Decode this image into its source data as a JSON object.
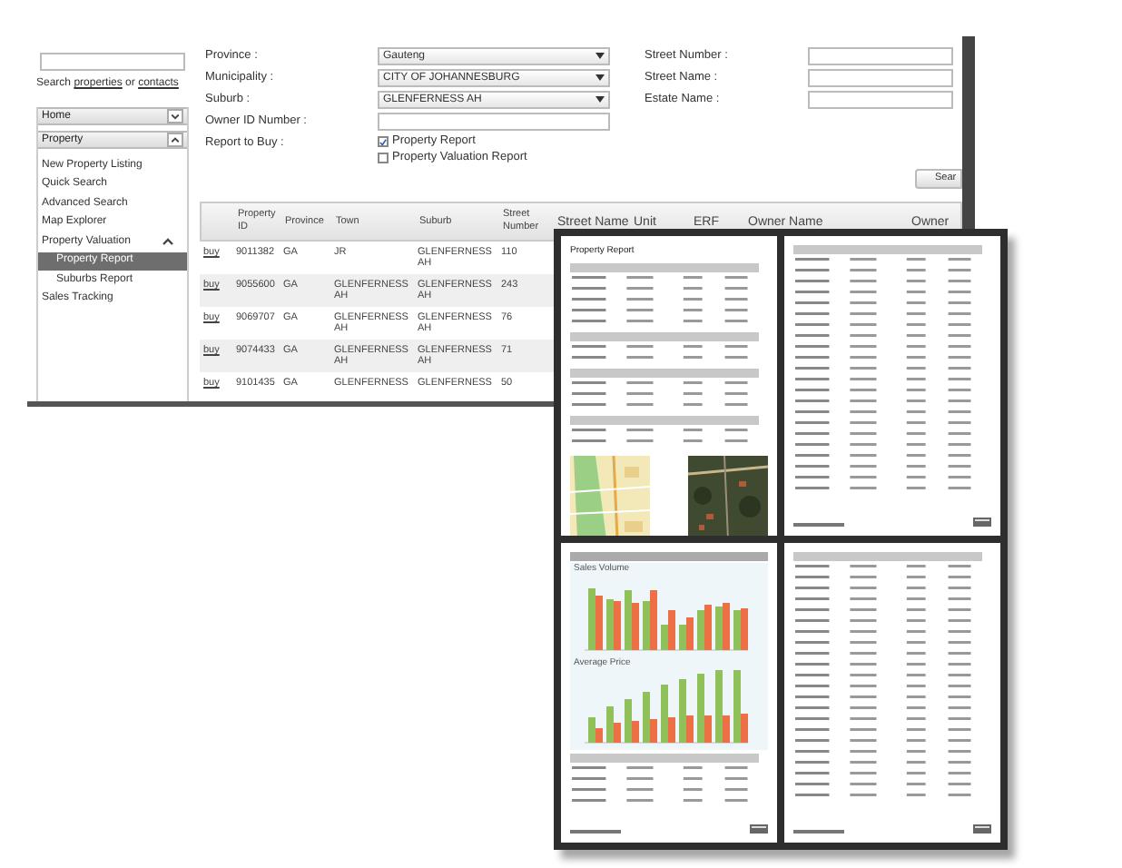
{
  "sidebar": {
    "search": {
      "hint": {
        "before": "Search",
        "link_1": "properties",
        "middle": "or",
        "link_2": "contacts"
      }
    },
    "nav": [
      {
        "label": "Home",
        "expanded": false
      },
      {
        "label": "Property",
        "expanded": true,
        "children": [
          {
            "label": "New Property Listing",
            "selected": false
          },
          {
            "label": "Quick Search",
            "selected": false
          },
          {
            "label": "Advanced Search",
            "selected": false
          },
          {
            "label": "Map Explorer",
            "selected": false
          },
          {
            "label": "Property Valuation",
            "selected": false,
            "expanded": true,
            "children": [
              {
                "label": "Property Report",
                "selected": true
              },
              {
                "label": "Suburbs Report",
                "selected": false
              }
            ]
          },
          {
            "label": "Sales Tracking",
            "selected": false
          }
        ]
      }
    ]
  },
  "form": {
    "left_fields": [
      {
        "label": "Province :",
        "kind": "select",
        "value": "Gauteng"
      },
      {
        "label": "Municipality :",
        "kind": "select",
        "value": "CITY OF JOHANNESBURG"
      },
      {
        "label": "Suburb :",
        "kind": "select",
        "value": "GLENFERNESS AH"
      },
      {
        "label": "Owner ID Number :",
        "kind": "text"
      }
    ],
    "report_to_buy": {
      "label": "Report to Buy :",
      "options": [
        {
          "label": "Property Report",
          "checked": true
        },
        {
          "label": "Property Valuation Report",
          "checked": false
        }
      ]
    },
    "right_fields": [
      {
        "label": "Street Number :"
      },
      {
        "label": "Street Name :"
      },
      {
        "label": "Estate Name :"
      }
    ],
    "search_button": "Sear"
  },
  "table": {
    "columns": [
      "Property ID",
      "Province",
      "Town",
      "Suburb",
      "Street Number",
      "Street Name",
      "Unit",
      "ERF",
      "Owner Name",
      "Owner"
    ],
    "rows": [
      {
        "link": "buy",
        "cells": [
          "9011382",
          "GA",
          "JR",
          "GLENFERNESS AH",
          "110"
        ]
      },
      {
        "link": "buy",
        "cells": [
          "9055600",
          "GA",
          "GLENFERNESS AH",
          "GLENFERNESS AH",
          "243"
        ]
      },
      {
        "link": "buy",
        "cells": [
          "9069707",
          "GA",
          "GLENFERNESS AH",
          "GLENFERNESS AH",
          "76"
        ]
      },
      {
        "link": "buy",
        "cells": [
          "9074433",
          "GA",
          "GLENFERNESS AH",
          "GLENFERNESS AH",
          "71"
        ]
      },
      {
        "link": "buy",
        "cells": [
          "9101435",
          "GA",
          "GLENFERNESS",
          "GLENFERNESS",
          "50"
        ]
      }
    ]
  },
  "report_pages": [
    {
      "kind": "property_report",
      "title": "Property Report"
    },
    {
      "kind": "table"
    },
    {
      "kind": "charts",
      "chart_titles": [
        "Sales Volume",
        "Average Price"
      ]
    },
    {
      "kind": "table"
    }
  ]
}
